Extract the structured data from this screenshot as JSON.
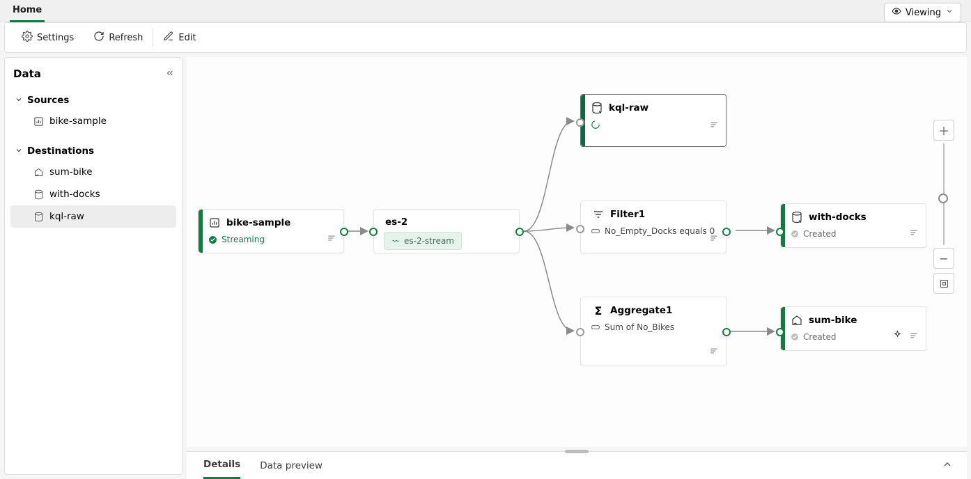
{
  "topTab": "Home",
  "modeButton": "Viewing",
  "toolbar": {
    "settings": "Settings",
    "refresh": "Refresh",
    "edit": "Edit"
  },
  "sidebar": {
    "title": "Data",
    "sections": {
      "sources": {
        "label": "Sources",
        "items": [
          "bike-sample"
        ]
      },
      "destinations": {
        "label": "Destinations",
        "items": [
          "sum-bike",
          "with-docks",
          "kql-raw"
        ]
      }
    },
    "selected": "kql-raw"
  },
  "nodes": {
    "bikeSample": {
      "title": "bike-sample",
      "status": "Streaming"
    },
    "es2": {
      "title": "es-2",
      "stream": "es-2-stream"
    },
    "kqlRaw": {
      "title": "kql-raw"
    },
    "filter1": {
      "title": "Filter1",
      "desc": "No_Empty_Docks equals 0"
    },
    "aggregate1": {
      "title": "Aggregate1",
      "desc": "Sum of No_Bikes"
    },
    "withDocks": {
      "title": "with-docks",
      "status": "Created"
    },
    "sumBike": {
      "title": "sum-bike",
      "status": "Created"
    }
  },
  "bottomTabs": {
    "details": "Details",
    "dataPreview": "Data preview"
  },
  "colors": {
    "accentGreen": "#107c41",
    "darkGreen": "#0b6a42"
  }
}
